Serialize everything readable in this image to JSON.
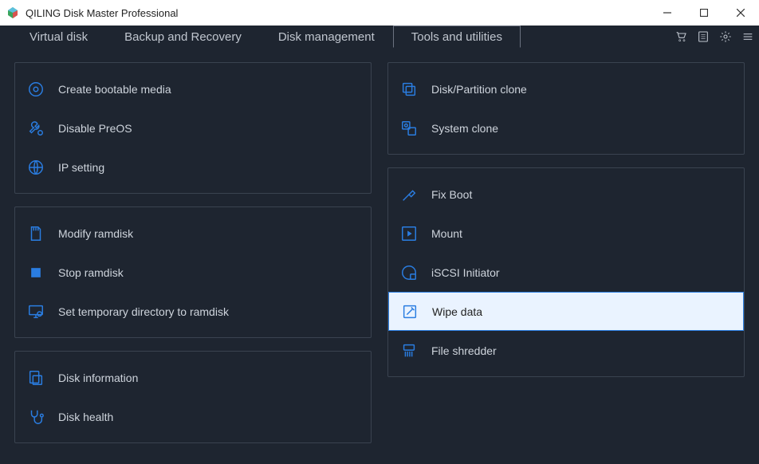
{
  "window": {
    "title": "QILING Disk Master Professional"
  },
  "tabs": {
    "virtual_disk": "Virtual disk",
    "backup_recovery": "Backup and Recovery",
    "disk_management": "Disk management",
    "tools_utilities": "Tools and utilities"
  },
  "left": {
    "group1": {
      "create_bootable_media": "Create bootable media",
      "disable_preos": "Disable PreOS",
      "ip_setting": "IP setting"
    },
    "group2": {
      "modify_ramdisk": "Modify ramdisk",
      "stop_ramdisk": "Stop ramdisk",
      "set_temp_dir": "Set temporary directory to ramdisk"
    },
    "group3": {
      "disk_information": "Disk information",
      "disk_health": "Disk health"
    }
  },
  "right": {
    "group1": {
      "disk_partition_clone": "Disk/Partition clone",
      "system_clone": "System clone"
    },
    "group2": {
      "fix_boot": "Fix Boot",
      "mount": "Mount",
      "iscsi_initiator": "iSCSI Initiator",
      "wipe_data": "Wipe data",
      "file_shredder": "File shredder"
    }
  }
}
